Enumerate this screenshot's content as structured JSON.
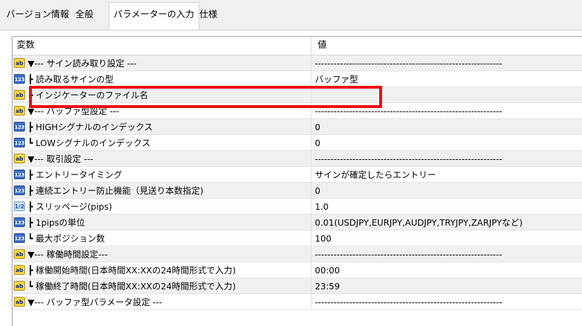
{
  "tabs": [
    {
      "label": "バージョン情報"
    },
    {
      "label": "全般"
    },
    {
      "label": "パラメーターの入力",
      "active": true
    },
    {
      "label": "仕様"
    }
  ],
  "table": {
    "header_name": "変数",
    "header_value": "値",
    "rows": [
      {
        "icon": "ab",
        "name": "▼--- サイン読み取り設定 ---",
        "value": "------------------------------------------------------------"
      },
      {
        "icon": "123",
        "name": "┣ 読み取るサインの型",
        "value": "バッファ型"
      },
      {
        "icon": "ab",
        "name": "┗ インジケーターのファイル名",
        "value": ""
      },
      {
        "icon": "ab",
        "name": "▼--- バッファ型設定 ---",
        "value": "------------------------------------------------------------"
      },
      {
        "icon": "123",
        "name": "┣ HIGHシグナルのインデックス",
        "value": "0"
      },
      {
        "icon": "123",
        "name": "┗ LOWシグナルのインデックス",
        "value": "0"
      },
      {
        "icon": "ab",
        "name": "▼--- 取引設定 ---",
        "value": "------------------------------------------------------------"
      },
      {
        "icon": "123",
        "name": "┣ エントリータイミング",
        "value": "サインが確定したらエントリー"
      },
      {
        "icon": "123",
        "name": "┣ 連続エントリー防止機能（見送り本数指定)",
        "value": "0"
      },
      {
        "icon": "1/2",
        "name": "┣ スリッページ(pips)",
        "value": "1.0"
      },
      {
        "icon": "123",
        "name": "┣ 1pipsの単位",
        "value": "0.01(USDJPY,EURJPY,AUDJPY,TRYJPY,ZARJPYなど)"
      },
      {
        "icon": "123",
        "name": "┗ 最大ポジション数",
        "value": "100"
      },
      {
        "icon": "ab",
        "name": "▼--- 稼働時間設定---",
        "value": "------------------------------------------------------------"
      },
      {
        "icon": "ab",
        "name": "┣ 稼働開始時間(日本時間XX:XXの24時間形式で入力)",
        "value": "00:00"
      },
      {
        "icon": "ab",
        "name": "┗ 稼働終了時間(日本時間XX:XXの24時間形式で入力)",
        "value": "23:59"
      },
      {
        "icon": "ab",
        "name": "▼--- バッファ型パラメータ設定 ---",
        "value": "------------------------------------------------------------"
      }
    ]
  }
}
